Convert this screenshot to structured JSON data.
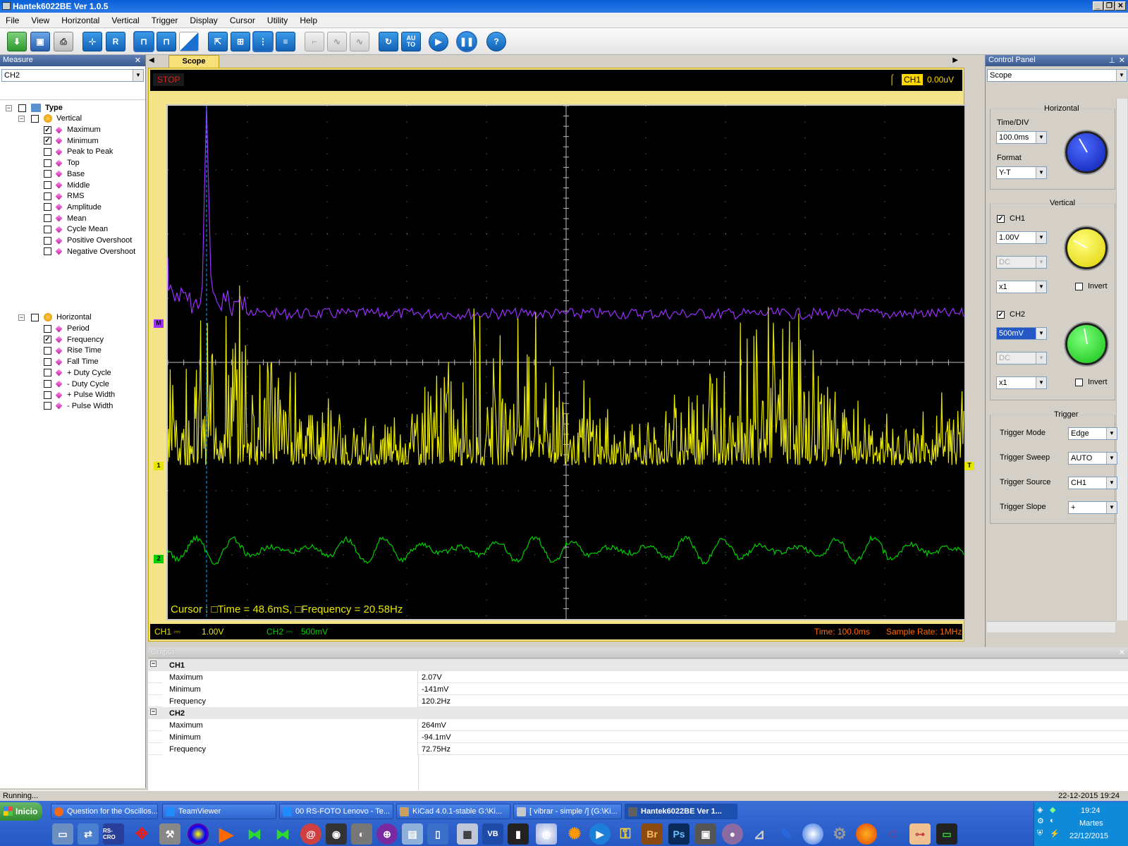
{
  "window": {
    "title": "Hantek6022BE Ver 1.0.5",
    "minimize": "_",
    "restore": "❐",
    "close": "✕"
  },
  "menu": [
    "File",
    "View",
    "Horizontal",
    "Vertical",
    "Trigger",
    "Display",
    "Cursor",
    "Utility",
    "Help"
  ],
  "toolbar": {
    "r_label": "R",
    "auto_label": "AU\nTO",
    "help_label": "?"
  },
  "measure": {
    "panel_title": "Measure",
    "channel": "CH2",
    "tree": {
      "root": "Type",
      "vertical": {
        "label": "Vertical",
        "items": [
          {
            "label": "Maximum",
            "checked": "✓"
          },
          {
            "label": "Minimum",
            "checked": "✓"
          },
          {
            "label": "Peak to Peak",
            "checked": ""
          },
          {
            "label": "Top",
            "checked": ""
          },
          {
            "label": "Base",
            "checked": ""
          },
          {
            "label": "Middle",
            "checked": ""
          },
          {
            "label": "RMS",
            "checked": ""
          },
          {
            "label": "Amplitude",
            "checked": ""
          },
          {
            "label": "Mean",
            "checked": ""
          },
          {
            "label": "Cycle Mean",
            "checked": ""
          },
          {
            "label": "Positive Overshoot",
            "checked": ""
          },
          {
            "label": "Negative Overshoot",
            "checked": ""
          }
        ]
      },
      "horizontal": {
        "label": "Horizontal",
        "items": [
          {
            "label": "Period",
            "checked": ""
          },
          {
            "label": "Frequency",
            "checked": "✓"
          },
          {
            "label": "Rise Time",
            "checked": ""
          },
          {
            "label": "Fall Time",
            "checked": ""
          },
          {
            "label": "+ Duty Cycle",
            "checked": ""
          },
          {
            "label": "- Duty Cycle",
            "checked": ""
          },
          {
            "label": "+ Pulse Width",
            "checked": ""
          },
          {
            "label": "- Pulse Width",
            "checked": ""
          }
        ]
      }
    }
  },
  "scope": {
    "tab": "Scope",
    "status": "STOP",
    "trigger_channel": "CH1",
    "trigger_level": "0.00uV",
    "cursor_readout": "Cursor : □Time = 48.6mS, □Frequency = 20.58Hz",
    "marker_math": "M",
    "marker_ch1": "1",
    "marker_ch2": "2",
    "marker_trigger": "T",
    "ch1_label": "CH1 ⎓",
    "ch1_scale": "1.00V",
    "ch2_label": "CH2 ⎓",
    "ch2_scale": "500mV",
    "time_readout": "Time: 100.0ms",
    "sample_rate": "Sample Rate: 1MHz",
    "colors": {
      "ch1": "#e6e600",
      "ch2": "#00d000",
      "math": "#9b30ff",
      "cursor": "#00aaff"
    }
  },
  "control_panel": {
    "title": "Control Panel",
    "mode": "Scope",
    "horizontal": {
      "title": "Horizontal",
      "timediv_label": "Time/DIV",
      "timediv": "100.0ms",
      "format_label": "Format",
      "format": "Y-T"
    },
    "vertical": {
      "title": "Vertical",
      "ch1": {
        "label": "CH1",
        "checked": "✓",
        "volts": "1.00V",
        "coupling": "DC",
        "probe": "x1",
        "invert_label": "Invert",
        "invert": ""
      },
      "ch2": {
        "label": "CH2",
        "checked": "✓",
        "volts": "500mV",
        "coupling": "DC",
        "probe": "x1",
        "invert_label": "Invert",
        "invert": ""
      }
    },
    "trigger": {
      "title": "Trigger",
      "mode_label": "Trigger Mode",
      "mode": "Edge",
      "sweep_label": "Trigger Sweep",
      "sweep": "AUTO",
      "source_label": "Trigger Source",
      "source": "CH1",
      "slope_label": "Trigger Slope",
      "slope": "+"
    }
  },
  "output": {
    "title": "Output",
    "groups": [
      {
        "name": "CH1",
        "rows": [
          {
            "k": "Maximum",
            "v": "2.07V"
          },
          {
            "k": "Minimum",
            "v": "-141mV"
          },
          {
            "k": "Frequency",
            "v": "120.2Hz"
          }
        ]
      },
      {
        "name": "CH2",
        "rows": [
          {
            "k": "Maximum",
            "v": "264mV"
          },
          {
            "k": "Minimum",
            "v": "-94.1mV"
          },
          {
            "k": "Frequency",
            "v": "72.75Hz"
          }
        ]
      }
    ]
  },
  "statusbar": {
    "text": "Running...",
    "datetime": "22-12-2015  19:24"
  },
  "taskbar": {
    "start": "Inicio",
    "tasks": [
      "Question for the Oscillos...",
      "TeamViewer",
      "00 RS-FOTO Lenovo - Te...",
      "KiCad 4.0.1-stable G:\\Ki...",
      "[ vibrar - simple /] (G:\\Ki...",
      "Hantek6022BE Ver 1..."
    ],
    "quick_labels": {
      "br": "Br",
      "ps": "Ps",
      "rscro": "RS-CRO"
    },
    "clock_time": "19:24",
    "clock_day": "Martes",
    "clock_date": "22/12/2015"
  }
}
